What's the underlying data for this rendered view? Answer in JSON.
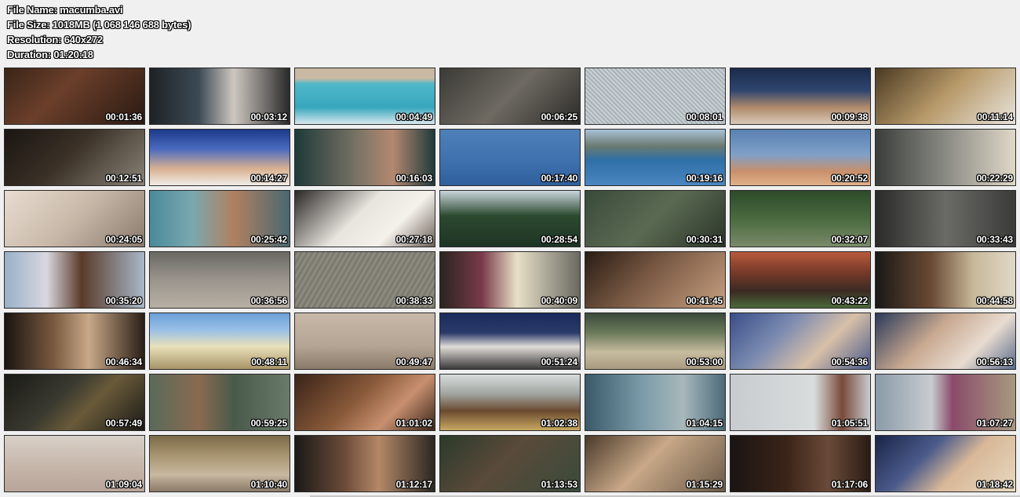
{
  "header": {
    "file_name": "File Name: macumba.avi",
    "file_size": "File Size: 1018MB (1 068 146 688 bytes)",
    "resolution": "Resolution: 640x272",
    "duration": "Duration: 01:20:18"
  },
  "thumbnails": [
    {
      "time": "00:01:36",
      "bg": "linear-gradient(135deg,#3a2418 0%,#6b3f2a 40%,#2a1a12 100%)",
      "icon": "film-frame-icon"
    },
    {
      "time": "00:03:12",
      "bg": "linear-gradient(90deg,#1e2226 0%,#3c4a55 35%,#cfc7c0 60%,#2a2a2a 100%)",
      "icon": "film-frame-icon"
    },
    {
      "time": "00:04:49",
      "bg": "linear-gradient(180deg,#c9b9a3 0%,#c9b9a3 18%,#4fb8c9 28%,#37a7bd 70%,#d9e8ee 100%)",
      "icon": "film-frame-icon"
    },
    {
      "time": "00:06:25",
      "bg": "linear-gradient(135deg,#3b3a36 0%,#6e6a62 50%,#2c2b28 100%)",
      "icon": "film-frame-icon"
    },
    {
      "time": "00:08:01",
      "bg": "repeating-linear-gradient(45deg,#a9b3b8 0 2px,#c8d0d4 2px 4px)",
      "icon": "film-frame-icon"
    },
    {
      "time": "00:09:38",
      "bg": "linear-gradient(180deg,#1b2a4a 0%,#2f4670 40%,#b08a6a 70%,#d8c8b8 100%)",
      "icon": "film-frame-icon"
    },
    {
      "time": "00:11:14",
      "bg": "linear-gradient(135deg,#4a3a22 0%,#b89a6a 50%,#e8e4dc 100%)",
      "icon": "film-frame-icon"
    },
    {
      "time": "00:12:51",
      "bg": "linear-gradient(135deg,#1a1612 0%,#3a3026 45%,#8a8278 100%)",
      "icon": "film-frame-icon"
    },
    {
      "time": "00:14:27",
      "bg": "linear-gradient(180deg,#1d3a8a 0%,#4a6ac0 35%,#d8b090 70%,#f0ece6 100%)",
      "icon": "film-frame-icon"
    },
    {
      "time": "00:16:03",
      "bg": "linear-gradient(90deg,#1e3a38 0%,#7a7466 45%,#b48870 70%,#1f3a3a 100%)",
      "icon": "film-frame-icon"
    },
    {
      "time": "00:17:40",
      "bg": "linear-gradient(180deg,#4e7fb8 0%,#3d70ad 60%,#2f5f9c 100%)",
      "icon": "film-frame-icon"
    },
    {
      "time": "00:19:16",
      "bg": "linear-gradient(180deg,#a8c0d8 0%,#6a7a70 30%,#2f6fa8 55%,#4a86c0 100%)",
      "icon": "film-frame-icon"
    },
    {
      "time": "00:20:52",
      "bg": "linear-gradient(180deg,#5a80b0 0%,#7fa0c8 45%,#c8906a 75%,#e0b08a 100%)",
      "icon": "film-frame-icon"
    },
    {
      "time": "00:22:29",
      "bg": "linear-gradient(90deg,#3a3e3a 0%,#8a8a84 50%,#e0d8c8 100%)",
      "icon": "film-frame-icon"
    },
    {
      "time": "00:24:05",
      "bg": "linear-gradient(135deg,#e8dcd0 0%,#c8b8a8 50%,#8a7a6e 100%)",
      "icon": "film-frame-icon"
    },
    {
      "time": "00:25:42",
      "bg": "linear-gradient(90deg,#4a8a9a 0%,#7aa8b0 30%,#b08060 60%,#4a6870 100%)",
      "icon": "film-frame-icon"
    },
    {
      "time": "00:27:18",
      "bg": "linear-gradient(135deg,#2a2826 0%,#e8e4de 45%,#f4f0ea 70%,#6a6058 100%)",
      "icon": "film-frame-icon"
    },
    {
      "time": "00:28:54",
      "bg": "linear-gradient(180deg,#c8d4dc 0%,#2c4a30 45%,#1e3424 100%)",
      "icon": "film-frame-icon"
    },
    {
      "time": "00:30:31",
      "bg": "linear-gradient(135deg,#3a4a3a 0%,#5a6a52 50%,#2a3428 100%)",
      "icon": "film-frame-icon"
    },
    {
      "time": "00:32:07",
      "bg": "linear-gradient(180deg,#2e4a2a 0%,#4a6a3e 50%,#7a8a6a 100%)",
      "icon": "film-frame-icon"
    },
    {
      "time": "00:33:43",
      "bg": "linear-gradient(90deg,#2a2a28 0%,#6a6a66 50%,#3a3a38 100%)",
      "icon": "film-frame-icon"
    },
    {
      "time": "00:35:20",
      "bg": "linear-gradient(90deg,#9ab0c8 0%,#d8d8e0 30%,#5a3a2a 55%,#a8b8c8 100%)",
      "icon": "film-frame-icon"
    },
    {
      "time": "00:36:56",
      "bg": "linear-gradient(180deg,#6a6864 0%,#9a948c 50%,#b8b0a4 100%)",
      "icon": "film-frame-icon"
    },
    {
      "time": "00:38:33",
      "bg": "repeating-linear-gradient(120deg,#7a7a6e 0 3px,#8c8a7e 3px 6px)",
      "icon": "film-frame-icon"
    },
    {
      "time": "00:40:09",
      "bg": "linear-gradient(90deg,#2a2420 0%,#7a3a4a 30%,#e8e0c8 55%,#6a6a62 100%)",
      "icon": "film-frame-icon"
    },
    {
      "time": "00:41:45",
      "bg": "linear-gradient(135deg,#2a1c14 0%,#7a5a44 45%,#c8a080 100%)",
      "icon": "film-frame-icon"
    },
    {
      "time": "00:43:22",
      "bg": "linear-gradient(180deg,#b85a3a 0%,#7a3a2a 35%,#3a2a22 70%,#4a6a3a 100%)",
      "icon": "film-frame-icon"
    },
    {
      "time": "00:44:58",
      "bg": "linear-gradient(90deg,#1a1816 0%,#6a4a34 40%,#c8b89a 70%,#e0d8c8 100%)",
      "icon": "film-frame-icon"
    },
    {
      "time": "00:46:34",
      "bg": "linear-gradient(90deg,#1a1410 0%,#7a5a40 35%,#c8a888 60%,#2a1e16 100%)",
      "icon": "film-frame-icon"
    },
    {
      "time": "00:48:11",
      "bg": "linear-gradient(180deg,#6aa0d8 0%,#9ac0e8 30%,#e8e0b8 60%,#a89468 100%)",
      "icon": "film-frame-icon"
    },
    {
      "time": "00:49:47",
      "bg": "linear-gradient(180deg,#c8b8a8 0%,#b4a494 60%,#8a7a6a 100%)",
      "icon": "film-frame-icon"
    },
    {
      "time": "00:51:24",
      "bg": "linear-gradient(180deg,#1a2a5a 0%,#2a3a6a 35%,#e0dcd8 60%,#3a3a3a 100%)",
      "icon": "film-frame-icon"
    },
    {
      "time": "00:53:00",
      "bg": "linear-gradient(180deg,#3a4a3a 0%,#6a7a5a 35%,#c8bca0 70%,#a89a80 100%)",
      "icon": "film-frame-icon"
    },
    {
      "time": "00:54:36",
      "bg": "linear-gradient(135deg,#3a4e8a 0%,#7a8ab0 35%,#d8c0a8 65%,#4a5a8a 100%)",
      "icon": "film-frame-icon"
    },
    {
      "time": "00:56:13",
      "bg": "linear-gradient(135deg,#2a3a5a 0%,#c8a890 40%,#e8dcd0 70%,#5a6a8a 100%)",
      "icon": "film-frame-icon"
    },
    {
      "time": "00:57:49",
      "bg": "linear-gradient(135deg,#1a1a16 0%,#3a3a30 40%,#6a5a3a 60%,#1a1a16 100%)",
      "icon": "film-frame-icon"
    },
    {
      "time": "00:59:25",
      "bg": "linear-gradient(90deg,#5a6a5a 0%,#8a6a50 35%,#4a5a4a 60%,#6a7a6a 100%)",
      "icon": "film-frame-icon"
    },
    {
      "time": "01:01:02",
      "bg": "linear-gradient(135deg,#3a2418 0%,#8a5a3a 45%,#c89070 70%,#3a2418 100%)",
      "icon": "film-frame-icon"
    },
    {
      "time": "01:02:38",
      "bg": "linear-gradient(180deg,#d8dcdc 0%,#a0a4a0 35%,#6a4a30 65%,#c8a860 100%)",
      "icon": "film-frame-icon"
    },
    {
      "time": "01:04:15",
      "bg": "linear-gradient(90deg,#3a5a6a 0%,#7a9aa8 40%,#a8b8bc 70%,#4a6a78 100%)",
      "icon": "film-frame-icon"
    },
    {
      "time": "01:05:51",
      "bg": "linear-gradient(90deg,#c8ccd0 0%,#d8dcdc 60%,#7a4a3a 80%,#c8ccd0 100%)",
      "icon": "film-frame-icon"
    },
    {
      "time": "01:07:27",
      "bg": "linear-gradient(90deg,#8a9aa8 0%,#c8ccd0 40%,#8a4a6a 55%,#a89a80 100%)",
      "icon": "film-frame-icon"
    },
    {
      "time": "01:09:04",
      "bg": "linear-gradient(180deg,#d8d0c8 0%,#c8b8ac 50%,#b8a498 100%)",
      "icon": "film-frame-icon"
    },
    {
      "time": "01:10:40",
      "bg": "linear-gradient(180deg,#7a6a48 0%,#a89470 35%,#c8b8a0 70%,#8a7a68 100%)",
      "icon": "film-frame-icon"
    },
    {
      "time": "01:12:17",
      "bg": "linear-gradient(90deg,#1a1a18 0%,#6a4a38 35%,#b48868 60%,#2a2622 100%)",
      "icon": "film-frame-icon"
    },
    {
      "time": "01:13:53",
      "bg": "linear-gradient(135deg,#2a3a2a 0%,#5a4a3a 45%,#3a4a3a 100%)",
      "icon": "film-frame-icon"
    },
    {
      "time": "01:15:29",
      "bg": "linear-gradient(135deg,#4a3a2a 0%,#c8a888 45%,#6a5a48 100%)",
      "icon": "film-frame-icon"
    },
    {
      "time": "01:17:06",
      "bg": "linear-gradient(90deg,#1a1412 0%,#3a2418 40%,#6a4a38 70%,#2a1c14 100%)",
      "icon": "film-frame-icon"
    },
    {
      "time": "01:18:42",
      "bg": "linear-gradient(135deg,#1a2448 0%,#4a5a8a 35%,#d8b898 60%,#e8d8c0 100%)",
      "icon": "film-frame-icon"
    }
  ]
}
